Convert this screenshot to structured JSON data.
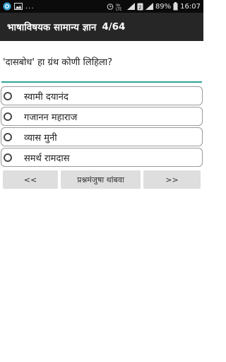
{
  "status_bar": {
    "ellipsis": "...",
    "signal_label": "Vo)) LTE",
    "battery": "89%",
    "time": "16:07"
  },
  "app_bar": {
    "title": "भाषाविषयक सामान्य ज्ञान",
    "progress": "4/64"
  },
  "question": {
    "text": "'दासबोध' हा ग्रंथ कोणी लिहिला?"
  },
  "options": [
    {
      "label": "स्वामी दयानंद"
    },
    {
      "label": "गजानन महाराज"
    },
    {
      "label": "व्यास मुनी"
    },
    {
      "label": "समर्थ रामदास"
    }
  ],
  "buttons": {
    "prev": "<<",
    "stop": "प्रश्नमंजुषा  थांबवा",
    "next": ">>"
  },
  "colors": {
    "app_bar_bg": "#262626",
    "accent_underline": "#2ea49a",
    "button_bg": "#dedede"
  }
}
